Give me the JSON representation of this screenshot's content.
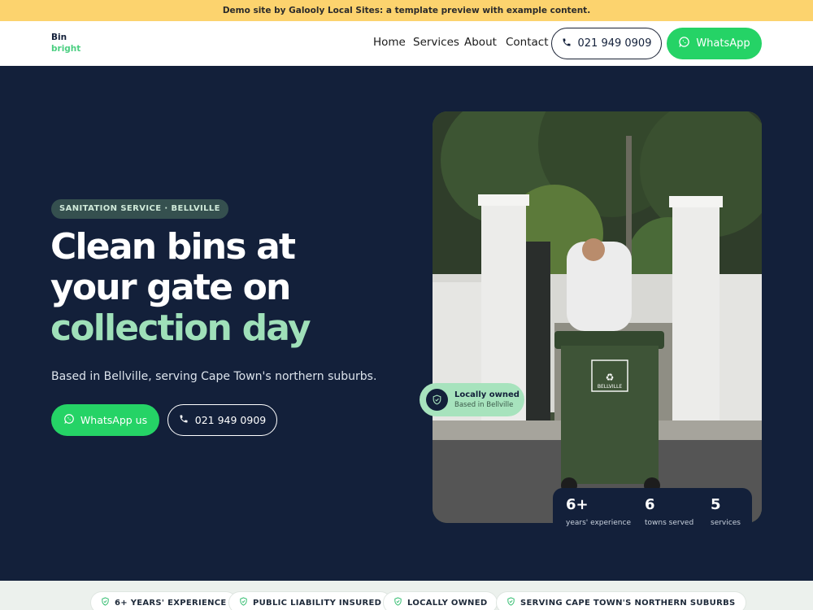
{
  "banner": {
    "text": "Demo site by Galooly Local Sites: a template preview with example content."
  },
  "logo": {
    "line1": "Bin",
    "line2": "bright"
  },
  "nav": {
    "links": [
      "Home",
      "Services",
      "About",
      "Contact"
    ],
    "phone_label": "021 949 0909",
    "whatsapp_label": "WhatsApp"
  },
  "hero": {
    "tag": "SANITATION SERVICE · BELLVILLE",
    "headline_line1": "Clean bins at",
    "headline_line2": "your gate on",
    "headline_accent": "collection day",
    "subtitle": "Based in Bellville, serving Cape Town's northern suburbs.",
    "cta_whatsapp": "WhatsApp us",
    "cta_phone": "021 949 0909"
  },
  "photo": {
    "bin_label": "BELLVILLE"
  },
  "badge": {
    "title": "Locally owned",
    "subtitle": "Based in Bellville"
  },
  "stats": [
    {
      "value": "6+",
      "label": "years' experience"
    },
    {
      "value": "6",
      "label": "towns served"
    },
    {
      "value": "5",
      "label": "services"
    }
  ],
  "trust": [
    "6+ YEARS' EXPERIENCE",
    "PUBLIC LIABILITY INSURED",
    "LOCALLY OWNED",
    "SERVING CAPE TOWN'S NORTHERN SUBURBS"
  ],
  "colors": {
    "navy": "#13203a",
    "green": "#25d366",
    "accent": "#9fe0b9",
    "banner": "#fcd36e"
  },
  "icons": {
    "phone": "phone-icon",
    "whatsapp": "whatsapp-icon",
    "shield": "shield-check-icon"
  }
}
